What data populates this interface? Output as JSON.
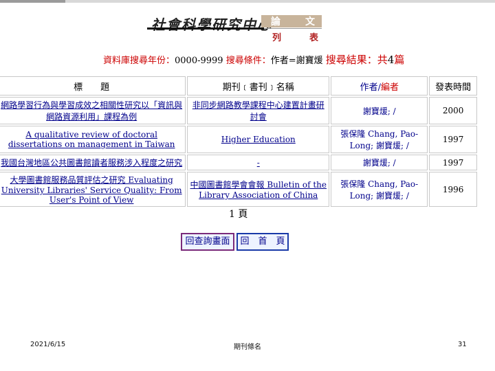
{
  "header": {
    "logo_text": "社會科學研究中心",
    "box_left": "論",
    "box_right": "文",
    "sub_left": "列",
    "sub_right": "表"
  },
  "criteria": {
    "label_years": "資料庫搜尋年份：",
    "years": "0000-9999",
    "label_condition": "搜尋條件：",
    "condition": "作者=謝寶煖",
    "label_result": "搜尋結果：共",
    "count": "4",
    "unit": "篇"
  },
  "table": {
    "headers": {
      "title": "標　　題",
      "journal": "期刊﹝書刊﹞名稱",
      "author_a": "作者/",
      "author_b": "編者",
      "date": "發表時間"
    },
    "rows": [
      {
        "title": "網路學習行為與學習成效之相關性研究以「資訊與網路資源利用」課程為例",
        "journal": "非同步網路教學課程中心建置計畫研討會",
        "author": "謝寶煖; /",
        "date": "2000"
      },
      {
        "title": "A qualitative review of doctoral dissertations on management in Taiwan",
        "journal": "Higher Education",
        "author": "張保隆 Chang, Pao-Long; 謝寶煖; /",
        "date": "1997"
      },
      {
        "title": "我國台灣地區公共圖書館讀者服務涉入程度之研究",
        "journal": "-",
        "author": "謝寶煖; /",
        "date": "1997"
      },
      {
        "title": "大學圖書館服務品質評估之研究 Evaluating University Libraries' Service Quality: From User's Point of View",
        "journal": "中國圖書館學會會報 Bulletin of the Library Association of China",
        "author": "張保隆 Chang, Pao-Long; 謝寶煖; /",
        "date": "1996"
      }
    ]
  },
  "pagination": {
    "page_label": "1 頁"
  },
  "buttons": {
    "back": "回查詢畫面",
    "home": "回　首　頁"
  },
  "footer": {
    "date": "2021/6/15",
    "center": "期刊條名",
    "page": "31"
  }
}
